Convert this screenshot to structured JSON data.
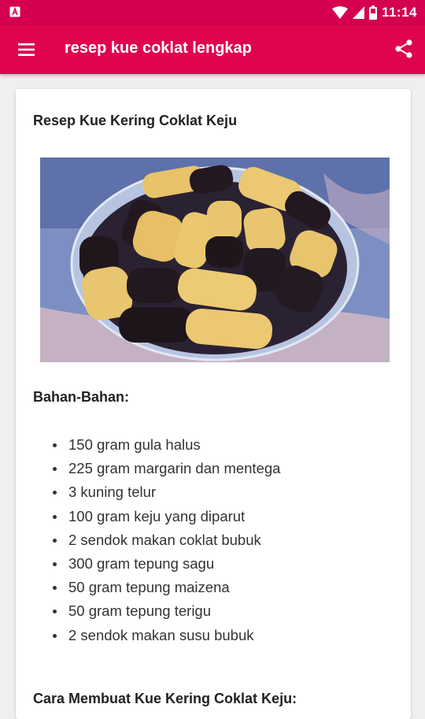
{
  "status_bar": {
    "time": "11:14",
    "icons": [
      "notification-icon",
      "wifi-icon",
      "signal-icon",
      "battery-icon"
    ]
  },
  "app_bar": {
    "title": "resep kue coklat lengkap",
    "icons": [
      "menu-icon",
      "share-icon"
    ]
  },
  "colors": {
    "accent": "#e0044f",
    "status_bar": "#d5004f",
    "background": "#efefef"
  },
  "recipe": {
    "title": "Resep Kue Kering Coklat Keju",
    "ingredients_heading": "Bahan-Bahan:",
    "ingredients": [
      "150 gram gula halus",
      "225 gram margarin dan mentega",
      "3 kuning telur",
      "100 gram keju yang diparut",
      "2 sendok makan coklat bubuk",
      "300 gram tepung sagu",
      "50 gram tepung maizena",
      "50 gram tepung terigu",
      "2 sendok makan susu bubuk"
    ],
    "method_heading": "Cara Membuat Kue Kering Coklat Keju:"
  }
}
